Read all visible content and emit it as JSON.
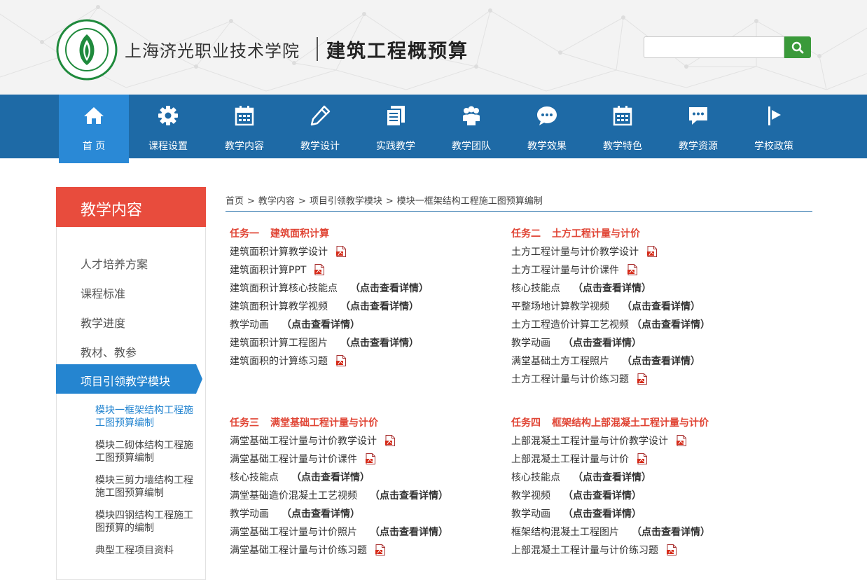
{
  "header": {
    "school_name": "上海济光职业技术学院",
    "course_name": "建筑工程概预算",
    "search": {
      "placeholder": "",
      "value": ""
    }
  },
  "nav": {
    "items": [
      {
        "label": "首 页",
        "icon": "home-icon",
        "active": true
      },
      {
        "label": "课程设置",
        "icon": "gear-icon",
        "active": false
      },
      {
        "label": "教学内容",
        "icon": "calendar-icon",
        "active": false
      },
      {
        "label": "教学设计",
        "icon": "pencil-icon",
        "active": false
      },
      {
        "label": "实践教学",
        "icon": "documents-icon",
        "active": false
      },
      {
        "label": "教学团队",
        "icon": "team-icon",
        "active": false
      },
      {
        "label": "教学效果",
        "icon": "chat-bubble-icon",
        "active": false
      },
      {
        "label": "教学特色",
        "icon": "calendar-icon",
        "active": false
      },
      {
        "label": "教学资源",
        "icon": "message-icon",
        "active": false
      },
      {
        "label": "学校政策",
        "icon": "flag-icon",
        "active": false
      }
    ]
  },
  "sidebar": {
    "title": "教学内容",
    "items": [
      "人才培养方案",
      "课程标准",
      "教学进度",
      "教材、教参"
    ],
    "active_item": "项目引领教学模块",
    "sub_items": [
      {
        "label": "模块一框架结构工程施工图预算编制",
        "current": true
      },
      {
        "label": "模块二砌体结构工程施工图预算编制",
        "current": false
      },
      {
        "label": "模块三剪力墙结构工程施工图预算编制",
        "current": false
      },
      {
        "label": "模块四钢结构工程施工图预算的编制",
        "current": false
      },
      {
        "label": "典型工程项目资料",
        "current": false
      }
    ]
  },
  "breadcrumb": [
    "首页",
    "教学内容",
    "项目引领教学模块",
    "模块一框架结构工程施工图预算编制"
  ],
  "breadcrumb_sep": ">",
  "detail_label": "（点击查看详情）",
  "tasks": [
    {
      "num": "任务一",
      "name": "建筑面积计算",
      "items": [
        {
          "text": "建筑面积计算教学设计",
          "kind": "pdf"
        },
        {
          "text": "建筑面积计算PPT",
          "kind": "pdf"
        },
        {
          "text": "建筑面积计算核心技能点",
          "kind": "detail"
        },
        {
          "text": "建筑面积计算教学视频",
          "kind": "detail"
        },
        {
          "text": "教学动画",
          "kind": "detail"
        },
        {
          "text": "建筑面积计算工程图片",
          "kind": "detail"
        },
        {
          "text": "建筑面积的计算练习题",
          "kind": "pdf"
        }
      ]
    },
    {
      "num": "任务二",
      "name": "土方工程计量与计价",
      "items": [
        {
          "text": "土方工程计量与计价教学设计",
          "kind": "pdf"
        },
        {
          "text": "土方工程计量与计价课件",
          "kind": "pdf"
        },
        {
          "text": "核心技能点",
          "kind": "detail"
        },
        {
          "text": "平整场地计算教学视频",
          "kind": "detail"
        },
        {
          "text": "土方工程造价计算工艺视频",
          "kind": "detail-tight"
        },
        {
          "text": "教学动画",
          "kind": "detail"
        },
        {
          "text": "满堂基础土方工程照片",
          "kind": "detail"
        },
        {
          "text": "土方工程计量与计价练习题",
          "kind": "pdf"
        }
      ]
    },
    {
      "num": "任务三",
      "name": "满堂基础工程计量与计价",
      "items": [
        {
          "text": "满堂基础工程计量与计价教学设计",
          "kind": "pdf"
        },
        {
          "text": "满堂基础工程计量与计价课件",
          "kind": "pdf"
        },
        {
          "text": "核心技能点",
          "kind": "detail"
        },
        {
          "text": "满堂基础造价混凝土工艺视频",
          "kind": "detail"
        },
        {
          "text": "教学动画",
          "kind": "detail"
        },
        {
          "text": "满堂基础工程计量与计价照片",
          "kind": "detail"
        },
        {
          "text": "满堂基础工程计量与计价练习题",
          "kind": "pdf"
        }
      ]
    },
    {
      "num": "任务四",
      "name": "框架结构上部混凝土工程计量与计价",
      "items": [
        {
          "text": "上部混凝土工程计量与计价教学设计",
          "kind": "pdf"
        },
        {
          "text": "上部混凝土工程计量与计价",
          "kind": "pdf"
        },
        {
          "text": "核心技能点",
          "kind": "detail"
        },
        {
          "text": "教学视频",
          "kind": "detail"
        },
        {
          "text": "教学动画",
          "kind": "detail"
        },
        {
          "text": "框架结构混凝土工程图片",
          "kind": "detail"
        },
        {
          "text": "上部混凝土工程计量与计价练习题",
          "kind": "pdf"
        }
      ]
    }
  ],
  "colors": {
    "nav_bg": "#1e6aa6",
    "nav_active": "#2a89d6",
    "sidebar_head": "#e84c3d",
    "sidebar_active": "#2585d0",
    "task_title": "#e04434",
    "search_btn": "#3a9a3a"
  }
}
